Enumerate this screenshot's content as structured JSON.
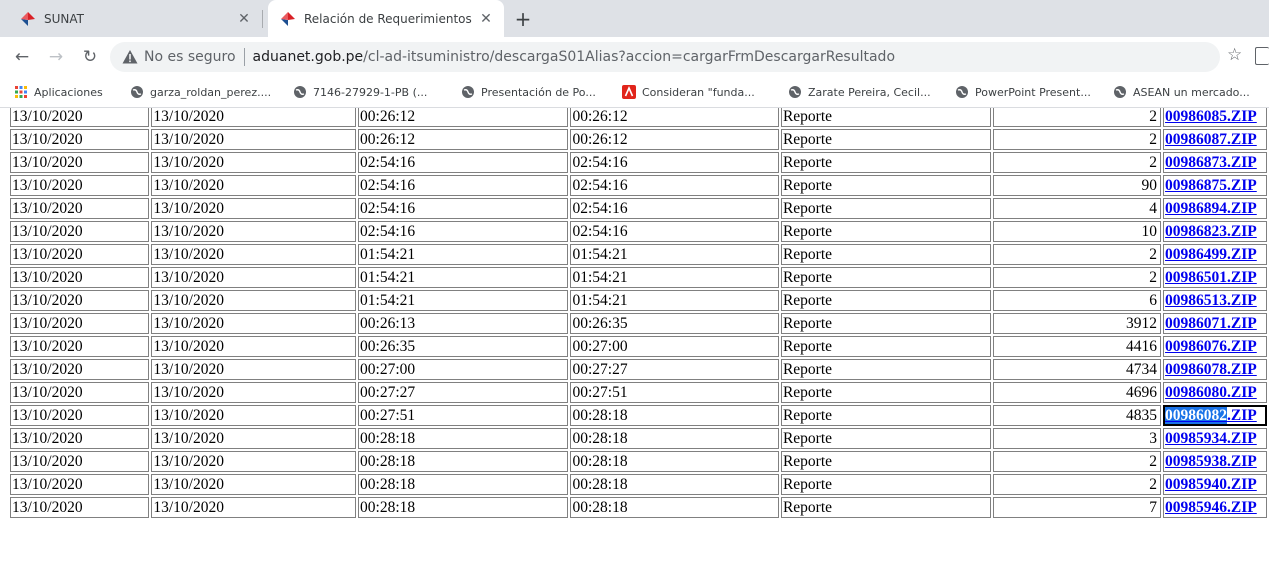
{
  "tabs": [
    {
      "title": "SUNAT",
      "active": false
    },
    {
      "title": "Relación de Requerimientos",
      "active": true
    }
  ],
  "toolbar": {
    "insecure_label": "No es seguro",
    "url_host": "aduanet.gob.pe",
    "url_path": "/cl-ad-itsuministro/descargaS01Alias?accion=cargarFrmDescargarResultado"
  },
  "bookmarks": [
    {
      "label": "Aplicaciones",
      "icon": "apps-grid-icon"
    },
    {
      "label": "garza_roldan_perez....",
      "icon": "globe-icon"
    },
    {
      "label": "7146-27929-1-PB (...",
      "icon": "globe-icon"
    },
    {
      "label": "Presentación de Po...",
      "icon": "globe-icon"
    },
    {
      "label": "Consideran \"funda...",
      "icon": "pdf-icon"
    },
    {
      "label": "Zarate Pereira, Cecil...",
      "icon": "globe-icon"
    },
    {
      "label": "PowerPoint Present...",
      "icon": "globe-icon"
    },
    {
      "label": "ASEAN un mercado...",
      "icon": "globe-icon"
    }
  ],
  "colors": {
    "link": "#0000ee",
    "selection": "#1a73e8",
    "tab_strip": "#dee1e6",
    "brand_red": "#d92026",
    "brand_blue": "#1d4f91"
  },
  "table": {
    "rows": [
      {
        "fecha1": "13/10/2020",
        "fecha2": "13/10/2020",
        "hora1": "00:26:12",
        "hora2": "00:26:12",
        "tipo": "Reporte",
        "cantidad": "2",
        "archivo_num": "00986085",
        "archivo_ext": ".ZIP"
      },
      {
        "fecha1": "13/10/2020",
        "fecha2": "13/10/2020",
        "hora1": "00:26:12",
        "hora2": "00:26:12",
        "tipo": "Reporte",
        "cantidad": "2",
        "archivo_num": "00986087",
        "archivo_ext": ".ZIP"
      },
      {
        "fecha1": "13/10/2020",
        "fecha2": "13/10/2020",
        "hora1": "02:54:16",
        "hora2": "02:54:16",
        "tipo": "Reporte",
        "cantidad": "2",
        "archivo_num": "00986873",
        "archivo_ext": ".ZIP"
      },
      {
        "fecha1": "13/10/2020",
        "fecha2": "13/10/2020",
        "hora1": "02:54:16",
        "hora2": "02:54:16",
        "tipo": "Reporte",
        "cantidad": "90",
        "archivo_num": "00986875",
        "archivo_ext": ".ZIP"
      },
      {
        "fecha1": "13/10/2020",
        "fecha2": "13/10/2020",
        "hora1": "02:54:16",
        "hora2": "02:54:16",
        "tipo": "Reporte",
        "cantidad": "4",
        "archivo_num": "00986894",
        "archivo_ext": ".ZIP"
      },
      {
        "fecha1": "13/10/2020",
        "fecha2": "13/10/2020",
        "hora1": "02:54:16",
        "hora2": "02:54:16",
        "tipo": "Reporte",
        "cantidad": "10",
        "archivo_num": "00986823",
        "archivo_ext": ".ZIP"
      },
      {
        "fecha1": "13/10/2020",
        "fecha2": "13/10/2020",
        "hora1": "01:54:21",
        "hora2": "01:54:21",
        "tipo": "Reporte",
        "cantidad": "2",
        "archivo_num": "00986499",
        "archivo_ext": ".ZIP"
      },
      {
        "fecha1": "13/10/2020",
        "fecha2": "13/10/2020",
        "hora1": "01:54:21",
        "hora2": "01:54:21",
        "tipo": "Reporte",
        "cantidad": "2",
        "archivo_num": "00986501",
        "archivo_ext": ".ZIP"
      },
      {
        "fecha1": "13/10/2020",
        "fecha2": "13/10/2020",
        "hora1": "01:54:21",
        "hora2": "01:54:21",
        "tipo": "Reporte",
        "cantidad": "6",
        "archivo_num": "00986513",
        "archivo_ext": ".ZIP"
      },
      {
        "fecha1": "13/10/2020",
        "fecha2": "13/10/2020",
        "hora1": "00:26:13",
        "hora2": "00:26:35",
        "tipo": "Reporte",
        "cantidad": "3912",
        "archivo_num": "00986071",
        "archivo_ext": ".ZIP"
      },
      {
        "fecha1": "13/10/2020",
        "fecha2": "13/10/2020",
        "hora1": "00:26:35",
        "hora2": "00:27:00",
        "tipo": "Reporte",
        "cantidad": "4416",
        "archivo_num": "00986076",
        "archivo_ext": ".ZIP"
      },
      {
        "fecha1": "13/10/2020",
        "fecha2": "13/10/2020",
        "hora1": "00:27:00",
        "hora2": "00:27:27",
        "tipo": "Reporte",
        "cantidad": "4734",
        "archivo_num": "00986078",
        "archivo_ext": ".ZIP"
      },
      {
        "fecha1": "13/10/2020",
        "fecha2": "13/10/2020",
        "hora1": "00:27:27",
        "hora2": "00:27:51",
        "tipo": "Reporte",
        "cantidad": "4696",
        "archivo_num": "00986080",
        "archivo_ext": ".ZIP"
      },
      {
        "fecha1": "13/10/2020",
        "fecha2": "13/10/2020",
        "hora1": "00:27:51",
        "hora2": "00:28:18",
        "tipo": "Reporte",
        "cantidad": "4835",
        "archivo_num": "00986082",
        "archivo_ext": ".ZIP",
        "selected": true
      },
      {
        "fecha1": "13/10/2020",
        "fecha2": "13/10/2020",
        "hora1": "00:28:18",
        "hora2": "00:28:18",
        "tipo": "Reporte",
        "cantidad": "3",
        "archivo_num": "00985934",
        "archivo_ext": ".ZIP"
      },
      {
        "fecha1": "13/10/2020",
        "fecha2": "13/10/2020",
        "hora1": "00:28:18",
        "hora2": "00:28:18",
        "tipo": "Reporte",
        "cantidad": "2",
        "archivo_num": "00985938",
        "archivo_ext": ".ZIP"
      },
      {
        "fecha1": "13/10/2020",
        "fecha2": "13/10/2020",
        "hora1": "00:28:18",
        "hora2": "00:28:18",
        "tipo": "Reporte",
        "cantidad": "2",
        "archivo_num": "00985940",
        "archivo_ext": ".ZIP"
      },
      {
        "fecha1": "13/10/2020",
        "fecha2": "13/10/2020",
        "hora1": "00:28:18",
        "hora2": "00:28:18",
        "tipo": "Reporte",
        "cantidad": "7",
        "archivo_num": "00985946",
        "archivo_ext": ".ZIP"
      }
    ]
  }
}
